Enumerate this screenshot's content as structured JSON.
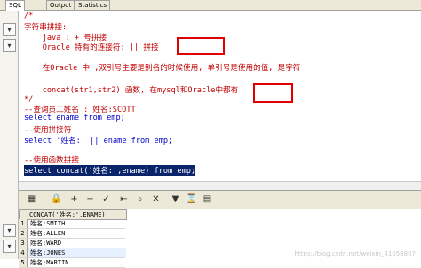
{
  "tabs": [
    {
      "label": "SQL",
      "active": true
    },
    {
      "label": "Output",
      "active": false
    },
    {
      "label": "Statistics",
      "active": false
    }
  ],
  "editor": {
    "lines": [
      {
        "text": "/*",
        "cls": "c-comment"
      },
      {
        "text": "字符串拼接:",
        "cls": "c-comment"
      },
      {
        "text": "    java : + 号拼接",
        "cls": "c-comment"
      },
      {
        "text": "    Oracle 特有的连接符: || 拼接",
        "cls": "c-comment"
      },
      {
        "text": "",
        "cls": ""
      },
      {
        "text": "    在Oracle 中 ,双引号主要是别名的时候使用, 单引号是使用的值, 是字符",
        "cls": "c-comment"
      },
      {
        "text": "",
        "cls": ""
      },
      {
        "text": "    concat(str1,str2) 函数, 在mysql和Oracle中都有",
        "cls": "c-comment"
      },
      {
        "text": "*/",
        "cls": "c-comment"
      },
      {
        "text": "--查询员工姓名 : 姓名:SCOTT",
        "cls": "c-comment"
      },
      {
        "text": "select ename from emp;",
        "cls": "sql1"
      },
      {
        "text": "--使用拼接符",
        "cls": "c-comment"
      },
      {
        "text": "select '姓名:' || ename from emp;",
        "cls": "sql2"
      },
      {
        "text": "",
        "cls": ""
      },
      {
        "text": "--使用函数拼接",
        "cls": "c-comment"
      },
      {
        "text": "select concat('姓名:',ename) from emp;",
        "cls": "selected"
      }
    ]
  },
  "grid": {
    "column": "CONCAT('姓名:',ENAME)",
    "rows": [
      {
        "num": "1",
        "value": "姓名:SMITH"
      },
      {
        "num": "2",
        "value": "姓名:ALLEN"
      },
      {
        "num": "3",
        "value": "姓名:WARD"
      },
      {
        "num": "4",
        "value": "姓名:JONES"
      },
      {
        "num": "5",
        "value": "姓名:MARTIN"
      }
    ]
  },
  "toolbar": {
    "icons": [
      "grid-icon",
      "lock-icon",
      "add-row-icon",
      "delete-row-icon",
      "post-icon",
      "first-icon",
      "prev-icon",
      "find-icon",
      "clear-icon",
      "next-icon",
      "filter-icon",
      "export-icon"
    ]
  },
  "watermark": "https://blog.csdn.net/weixin_41058807"
}
